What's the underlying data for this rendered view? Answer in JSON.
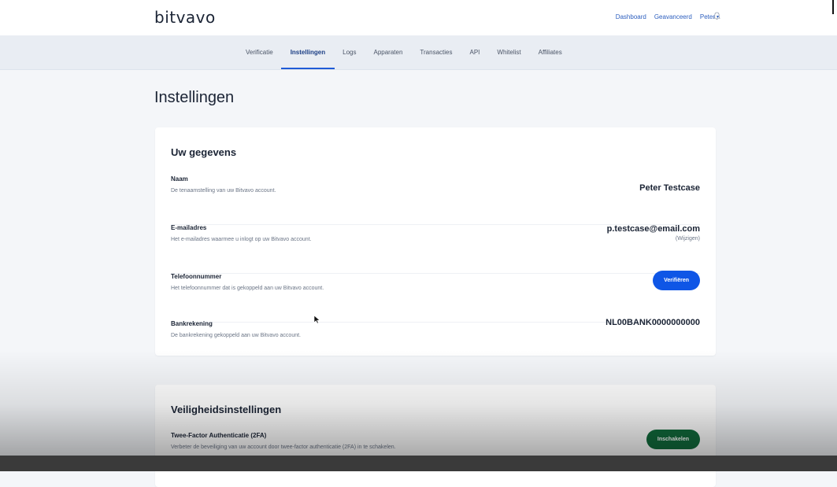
{
  "brand": {
    "logo": "bitvavo"
  },
  "topnav": {
    "dashboard": "Dashboard",
    "advanced": "Geavanceerd",
    "user": "Peter",
    "caret": "▾"
  },
  "tabs": [
    {
      "label": "Verificatie",
      "active": false
    },
    {
      "label": "Instellingen",
      "active": true
    },
    {
      "label": "Logs",
      "active": false
    },
    {
      "label": "Apparaten",
      "active": false
    },
    {
      "label": "Transacties",
      "active": false
    },
    {
      "label": "API",
      "active": false
    },
    {
      "label": "Whitelist",
      "active": false
    },
    {
      "label": "Affiliates",
      "active": false
    }
  ],
  "page": {
    "title": "Instellingen"
  },
  "details": {
    "title": "Uw gegevens",
    "name": {
      "label": "Naam",
      "description": "De tenaamstelling van uw Bitvavo account.",
      "value": "Peter Testcase"
    },
    "email": {
      "label": "E-mailadres",
      "description": "Het e-mailadres waarmee u inlogt op uw Bitvavo account.",
      "value": "p.testcase@email.com",
      "change_link": "(Wijzigen)"
    },
    "phone": {
      "label": "Telefoonnummer",
      "description": "Het telefoonnummer dat is gekoppeld aan uw Bitvavo account.",
      "button": "Verifiëren"
    },
    "bank": {
      "label": "Bankrekening",
      "description": "De bankrekening gekoppeld aan uw Bitvavo account.",
      "value": "NL00BANK0000000000"
    }
  },
  "security": {
    "title": "Veiligheidsinstellingen",
    "twofa": {
      "label": "Twee-Factor Authenticatie (2FA)",
      "description": "Verbeter de beveiliging van uw account door twee-factor authenticatie (2FA) in te schakelen.",
      "button": "Inschakelen"
    }
  },
  "colors": {
    "primary_blue": "#0f56e6",
    "enable_green": "#116b3c",
    "link_blue": "#2d5fbf",
    "page_bg": "#f4f6f9"
  },
  "icons": {
    "notifications": "bell-icon",
    "pointer": "mouse-cursor-icon"
  }
}
